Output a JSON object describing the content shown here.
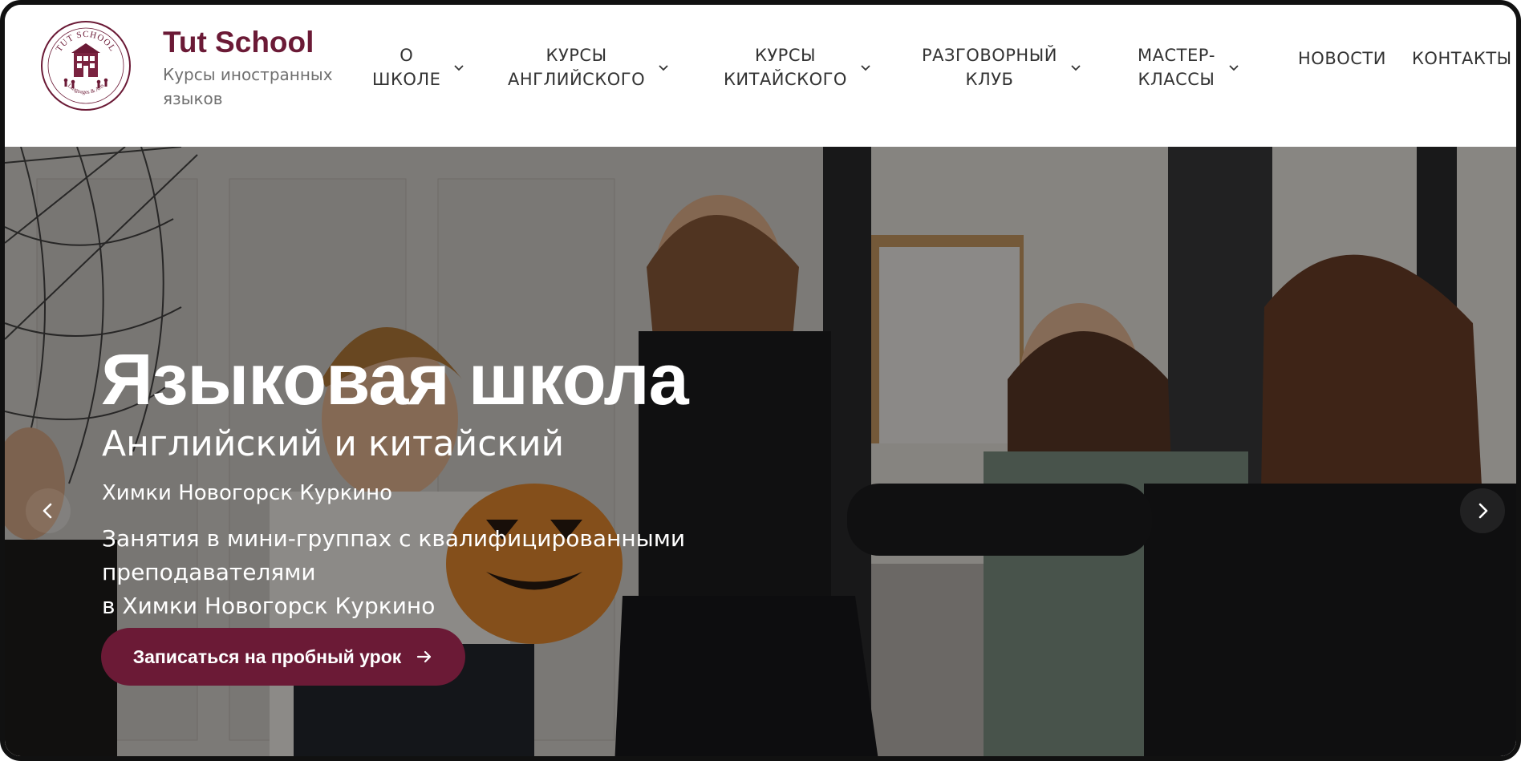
{
  "brand": {
    "title": "Tut School",
    "subtitle": "Курсы иностранных языков",
    "logo_text_top": "TUT SCHOOL",
    "logo_text_bottom": "Languages & Arts"
  },
  "nav": {
    "items": [
      {
        "label": "О\nШКОЛЕ",
        "has_dropdown": true
      },
      {
        "label": "КУРСЫ\nАНГЛИЙСКОГО",
        "has_dropdown": true
      },
      {
        "label": "КУРСЫ\nКИТАЙСКОГО",
        "has_dropdown": true
      },
      {
        "label": "РАЗГОВОРНЫЙ\nКЛУБ",
        "has_dropdown": true
      },
      {
        "label": "МАСТЕР-\nКЛАССЫ",
        "has_dropdown": true
      },
      {
        "label": "НОВОСТИ",
        "has_dropdown": false
      },
      {
        "label": "КОНТАКТЫ",
        "has_dropdown": false
      }
    ]
  },
  "hero": {
    "title": "Языковая школа",
    "subtitle": "Английский и китайский",
    "locations": "Химки Новогорск Куркино",
    "description": "Занятия в мини-группах с квалифицированными преподавателями\nв Химки Новогорск Куркино",
    "cta_label": "Записаться на пробный урок",
    "prev_icon": "chevron-left-icon",
    "next_icon": "chevron-right-icon"
  },
  "colors": {
    "brand": "#6b1a36",
    "nav_text": "#333333",
    "subtitle_text": "#707070",
    "hero_text": "#ffffff"
  }
}
